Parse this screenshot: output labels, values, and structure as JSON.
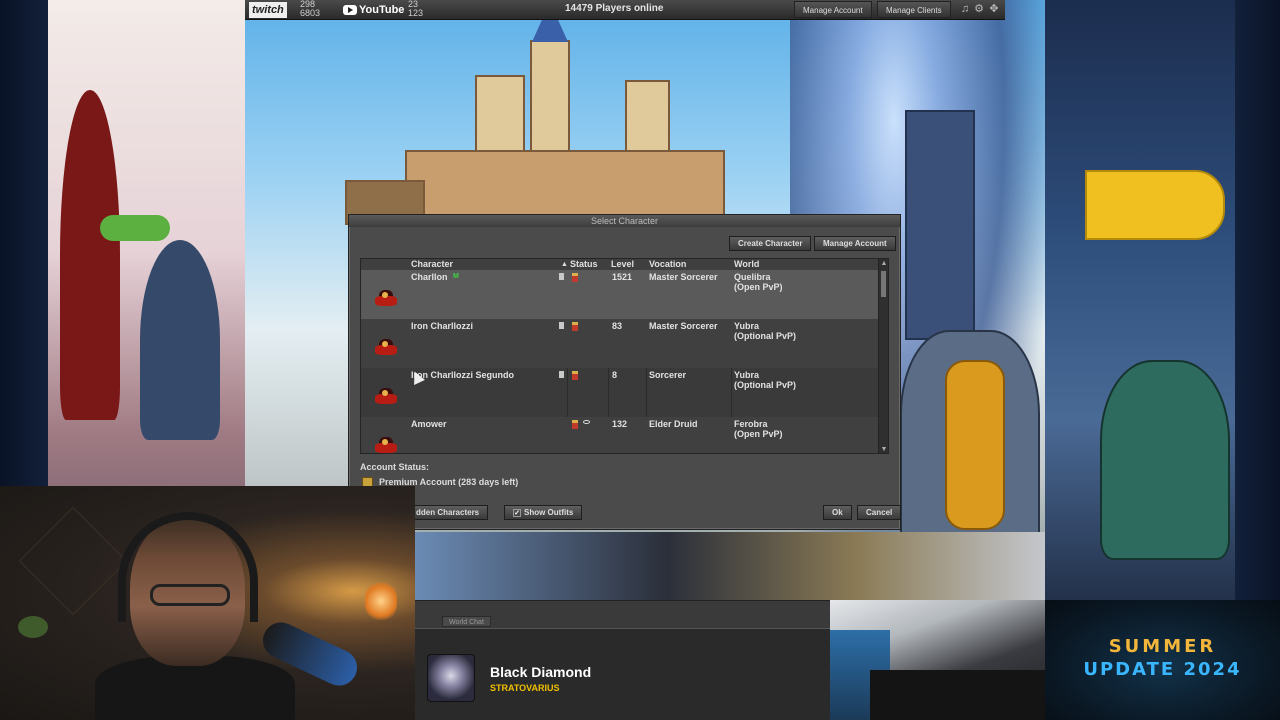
{
  "topbar": {
    "twitch": {
      "logo": "twitch",
      "followers": "298",
      "viewers": "6803"
    },
    "youtube": {
      "logo": "YouTube",
      "subs": "23",
      "viewers": "123"
    },
    "players_online": "14479 Players online",
    "manage_account": "Manage Account",
    "manage_clients": "Manage Clients",
    "icons": [
      "music-icon",
      "gear-icon",
      "expand-icon"
    ]
  },
  "dialog": {
    "title": "Select Character",
    "create_character": "Create Character",
    "manage_account": "Manage Account",
    "columns": [
      "Character",
      "Status",
      "Level",
      "Vocation",
      "World"
    ],
    "characters": [
      {
        "name": "Charllon",
        "level": "1521",
        "vocation": "Master Sorcerer",
        "world": "Quelibra",
        "pvp": "(Open PvP)",
        "selected": true
      },
      {
        "name": "Iron Charllozzi",
        "level": "83",
        "vocation": "Master Sorcerer",
        "world": "Yubra",
        "pvp": "(Optional PvP)"
      },
      {
        "name": "Iron Charllozzi Segundo",
        "level": "8",
        "vocation": "Sorcerer",
        "world": "Yubra",
        "pvp": "(Optional PvP)"
      },
      {
        "name": "Amower",
        "level": "132",
        "vocation": "Elder Druid",
        "world": "Ferobra",
        "pvp": "(Open PvP)"
      }
    ],
    "account_status_label": "Account Status:",
    "account_status_value": "Premium Account (283 days left)",
    "hidden_characters": "dden Characters",
    "show_outfits": "Show Outfits",
    "ok": "Ok",
    "cancel": "Cancel"
  },
  "chat": {
    "tab": "World Chat"
  },
  "now_playing": {
    "title": "Black Diamond",
    "artist": "STRATOVARIUS"
  },
  "promo": {
    "line1": "SUMMER",
    "line2": "UPDATE 2024"
  },
  "colors": {
    "dialog_bg": "#4b4b4b",
    "selected_row": "#5a5a5a",
    "artist": "#f0c000"
  }
}
